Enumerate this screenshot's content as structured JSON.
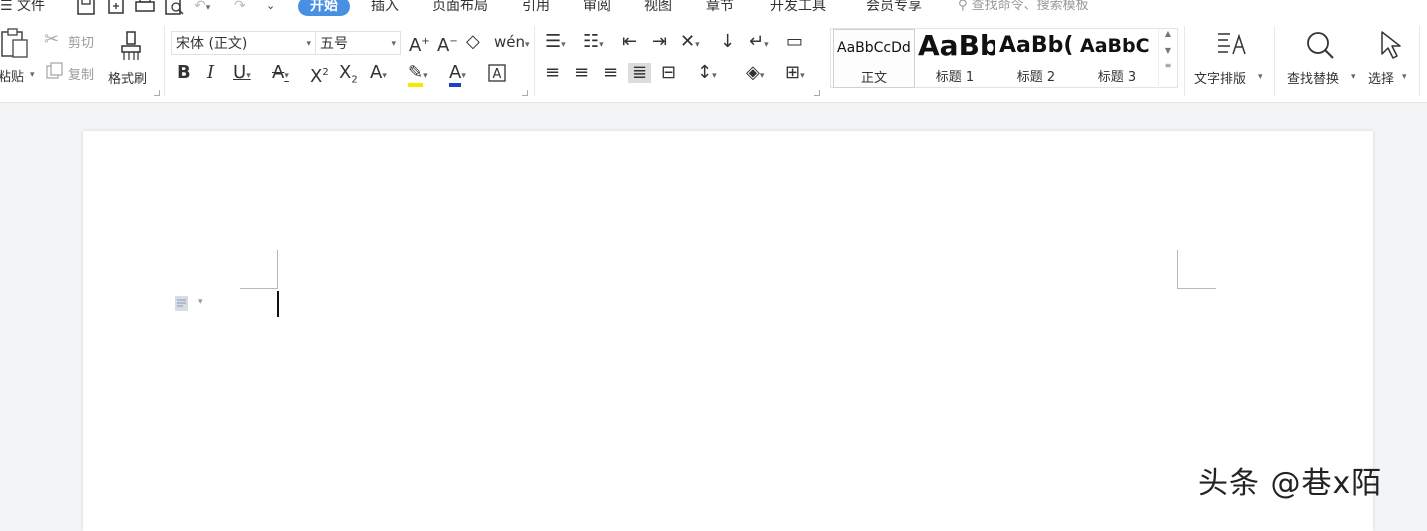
{
  "menubar": {
    "file_label": "文件",
    "tabs": [
      {
        "label": "开始",
        "active": true
      },
      {
        "label": "插入"
      },
      {
        "label": "页面布局"
      },
      {
        "label": "引用"
      },
      {
        "label": "审阅"
      },
      {
        "label": "视图"
      },
      {
        "label": "章节"
      },
      {
        "label": "开发工具"
      },
      {
        "label": "会员专享"
      }
    ],
    "search_placeholder": "查找命令、搜索模板",
    "active_color": "#4a90e2"
  },
  "clipboard": {
    "paste_label": "粘贴",
    "cut_label": "剪切",
    "copy_label": "复制",
    "format_painter_label": "格式刷"
  },
  "font": {
    "family_value": "宋体 (正文)",
    "size_value": "五号"
  },
  "styles": {
    "items": [
      {
        "preview": "AaBbCcDd",
        "name": "正文"
      },
      {
        "preview": "AaBb",
        "name": "标题 1"
      },
      {
        "preview": "AaBb(",
        "name": "标题 2"
      },
      {
        "preview": "AaBbC",
        "name": "标题 3"
      }
    ]
  },
  "tools": {
    "text_layout_label": "文字排版",
    "find_replace_label": "查找替换",
    "select_label": "选择"
  },
  "watermark": "头条 @巷x陌"
}
